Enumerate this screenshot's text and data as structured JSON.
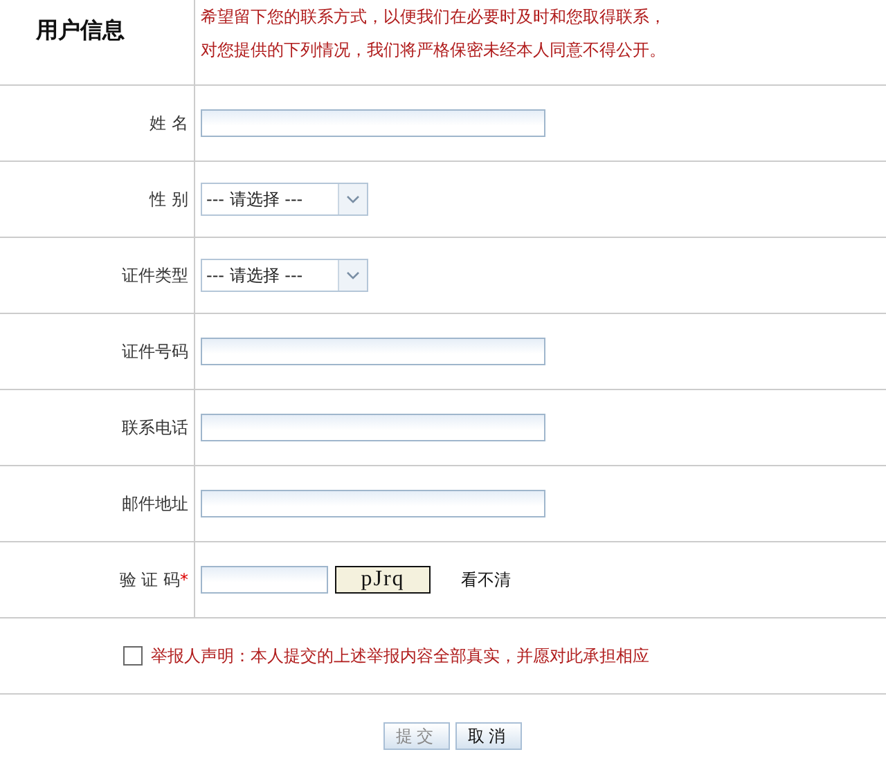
{
  "header": {
    "title": "用户信息",
    "notice": [
      "希望留下您的联系方式，以便我们在必要时及时和您取得联系，",
      "对您提供的下列情况，我们将严格保密未经本人同意不得公开。"
    ]
  },
  "fields": [
    {
      "kind": "text",
      "label": "姓 名"
    },
    {
      "kind": "select",
      "label": "性 别",
      "value": "--- 请选择 ---"
    },
    {
      "kind": "select",
      "label": "证件类型",
      "value": "--- 请选择 ---"
    },
    {
      "kind": "text",
      "label": "证件号码"
    },
    {
      "kind": "text",
      "label": "联系电话"
    },
    {
      "kind": "text",
      "label": "邮件地址"
    },
    {
      "kind": "captcha",
      "label": "验 证 码",
      "required": "*",
      "captcha": "pJrq",
      "refresh": "看不清"
    }
  ],
  "statement": {
    "checked": false,
    "text": "举报人声明：本人提交的上述举报内容全部真实，并愿对此承担相应"
  },
  "buttons": [
    {
      "label": "提交",
      "disabled": true
    },
    {
      "label": "取消",
      "disabled": false
    }
  ]
}
